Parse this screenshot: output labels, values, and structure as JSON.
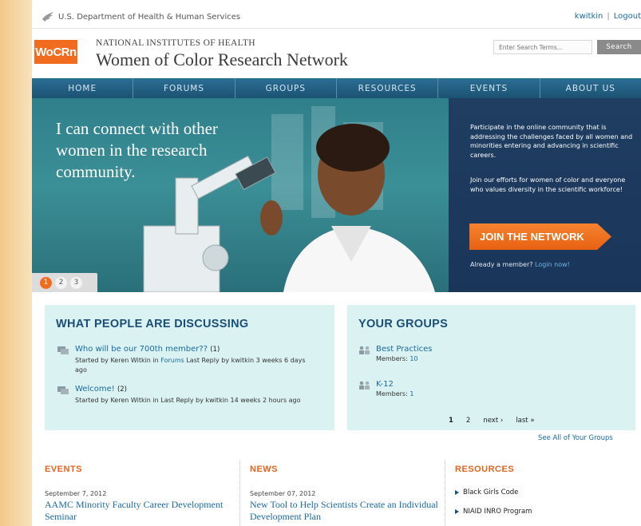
{
  "topbar": {
    "department": "U.S. Department of Health & Human Services",
    "user": "kwitkin",
    "separator": "|",
    "logout": "Logout"
  },
  "header": {
    "logo_text": "WoCRn",
    "org_name": "NATIONAL INSTITUTES OF HEALTH",
    "site_title": "Women of Color Research Network",
    "search_placeholder": "Enter Search Terms...",
    "search_button": "Search"
  },
  "nav": {
    "items": [
      {
        "label": "HOME"
      },
      {
        "label": "FORUMS"
      },
      {
        "label": "GROUPS"
      },
      {
        "label": "RESOURCES"
      },
      {
        "label": "EVENTS"
      },
      {
        "label": "ABOUT US"
      }
    ]
  },
  "hero": {
    "quote": "I can connect with other women in the research community.",
    "paragraph1": "Participate in the online community that is addressing the challenges faced by all women and minorities entering and advancing in scientific careers.",
    "paragraph2": "Join our efforts for women of color and everyone who values diversity in the scientific workforce!",
    "join_button": "JOIN THE NETWORK",
    "already_text": "Already a member?",
    "login_link": "Login now!",
    "slides": [
      "1",
      "2",
      "3"
    ],
    "active_slide": 0
  },
  "discussing": {
    "title": "WHAT PEOPLE ARE DISCUSSING",
    "items": [
      {
        "title": "Who will be our 700th member??",
        "count": "(1)",
        "meta_prefix": "Started by Keren Witkin in",
        "meta_link": "Forums",
        "meta_suffix": "Last Reply by kwitkin 3 weeks 6 days ago"
      },
      {
        "title": "Welcome!",
        "count": "(2)",
        "meta_prefix": "Started by Keren Witkin in",
        "meta_link": "",
        "meta_suffix": "Last Reply by kwitkin 14 weeks 2 hours ago"
      }
    ]
  },
  "groups": {
    "title": "YOUR GROUPS",
    "items": [
      {
        "name": "Best Practices",
        "members_label": "Members:",
        "members": "10"
      },
      {
        "name": "K-12",
        "members_label": "Members:",
        "members": "1"
      }
    ],
    "pager": {
      "page1": "1",
      "page2": "2",
      "next": "next ›",
      "last": "last »"
    },
    "see_all": "See All of Your Groups"
  },
  "events": {
    "title": "EVENTS",
    "date": "September 7, 2012",
    "headline": "AAMC Minority Faculty Career Development Seminar"
  },
  "news": {
    "title": "NEWS",
    "date": "September 07, 2012",
    "headline": "New Tool to Help Scientists Create an Individual Development Plan"
  },
  "resources": {
    "title": "RESOURCES",
    "items": [
      "Black Girls Code",
      "NIAID INRO Program"
    ]
  },
  "colors": {
    "accent_orange": "#f26c1f",
    "nav_blue": "#1b5273",
    "link_blue": "#1a6aa3",
    "panel_teal": "#daf2f1"
  }
}
